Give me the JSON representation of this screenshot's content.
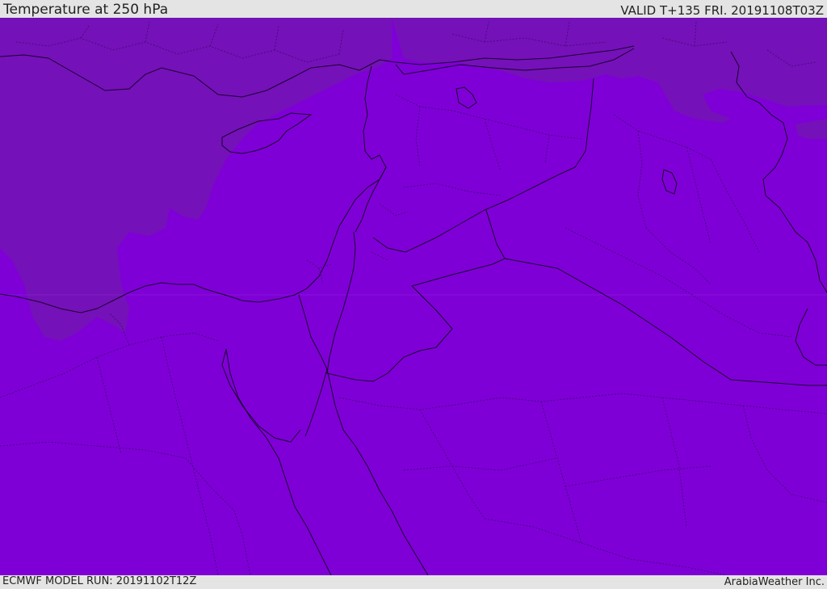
{
  "header": {
    "title": "Temperature at 250 hPa",
    "valid": "VALID T+135 FRI. 20191108T03Z"
  },
  "footer": {
    "model_run": "ECMWF MODEL RUN: 20191102T12Z",
    "credit": "ArabiaWeather Inc."
  },
  "map": {
    "colors": {
      "warm_band": "#7511b8",
      "main_fill": "#7f00d6",
      "borders": "#1a0030"
    }
  }
}
